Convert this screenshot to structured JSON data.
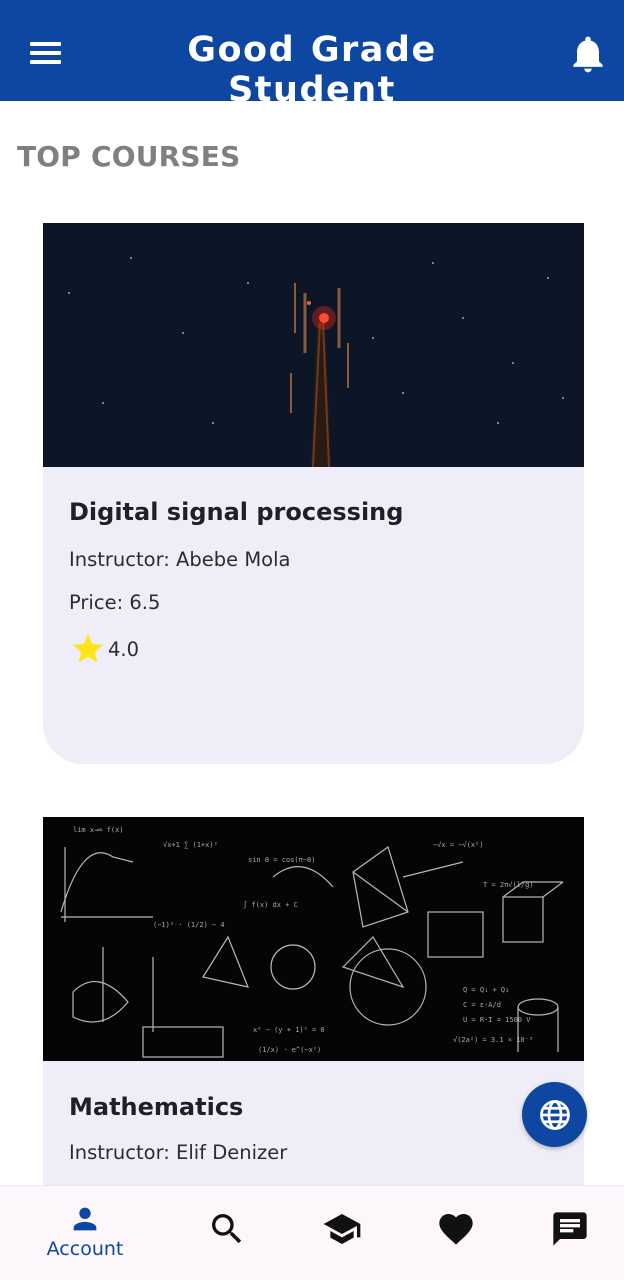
{
  "app": {
    "title": "Good Grade Student",
    "accent_color": "#0d47a1",
    "menu_icon": "hamburger-menu-icon",
    "notification_icon": "bell-icon"
  },
  "section": {
    "title": "TOP COURSES"
  },
  "courses": [
    {
      "name": "Digital signal processing",
      "instructor": "Instructor: Abebe Mola",
      "price": "Price: 6.5",
      "rating": "4.0",
      "image": "night-sky-cell-tower-photo"
    },
    {
      "name": "Mathematics",
      "instructor": "Instructor: Elif Denizer",
      "image": "chalkboard-math-formulas-photo"
    }
  ],
  "fab": {
    "icon": "globe-icon"
  },
  "bottom_nav": {
    "items": [
      {
        "label": "Account",
        "icon": "person-icon",
        "active": true
      },
      {
        "label": "",
        "icon": "search-icon"
      },
      {
        "label": "",
        "icon": "graduation-cap-icon"
      },
      {
        "label": "",
        "icon": "heart-icon"
      },
      {
        "label": "",
        "icon": "chat-icon"
      }
    ]
  }
}
